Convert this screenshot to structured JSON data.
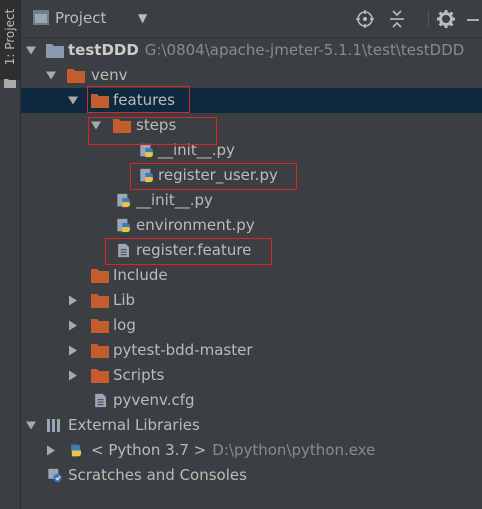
{
  "stripe": {
    "tab_label": "1: Project"
  },
  "header": {
    "title": "Project",
    "caret": "▼"
  },
  "tree": {
    "project": {
      "name": "testDDD",
      "path": "G:\\0804\\apache-jmeter-5.1.1\\test\\testDDD"
    },
    "venv": "venv",
    "features": "features",
    "steps": "steps",
    "steps_init": "__init__.py",
    "register_user": "register_user.py",
    "features_init": "__init__.py",
    "environment": "environment.py",
    "register_feature": "register.feature",
    "include": "Include",
    "lib": "Lib",
    "log": "log",
    "pytest_bdd": "pytest-bdd-master",
    "scripts": "Scripts",
    "pyvenv": "pyvenv.cfg",
    "external_libraries": "External Libraries",
    "python": {
      "name": "< Python 3.7 >",
      "path": "D:\\python\\python.exe"
    },
    "scratches": "Scratches and Consoles"
  },
  "colors": {
    "background": "#3c3f41",
    "selection": "#0d293e",
    "folder": "#c35c2e",
    "highlight": "#d9252f"
  }
}
